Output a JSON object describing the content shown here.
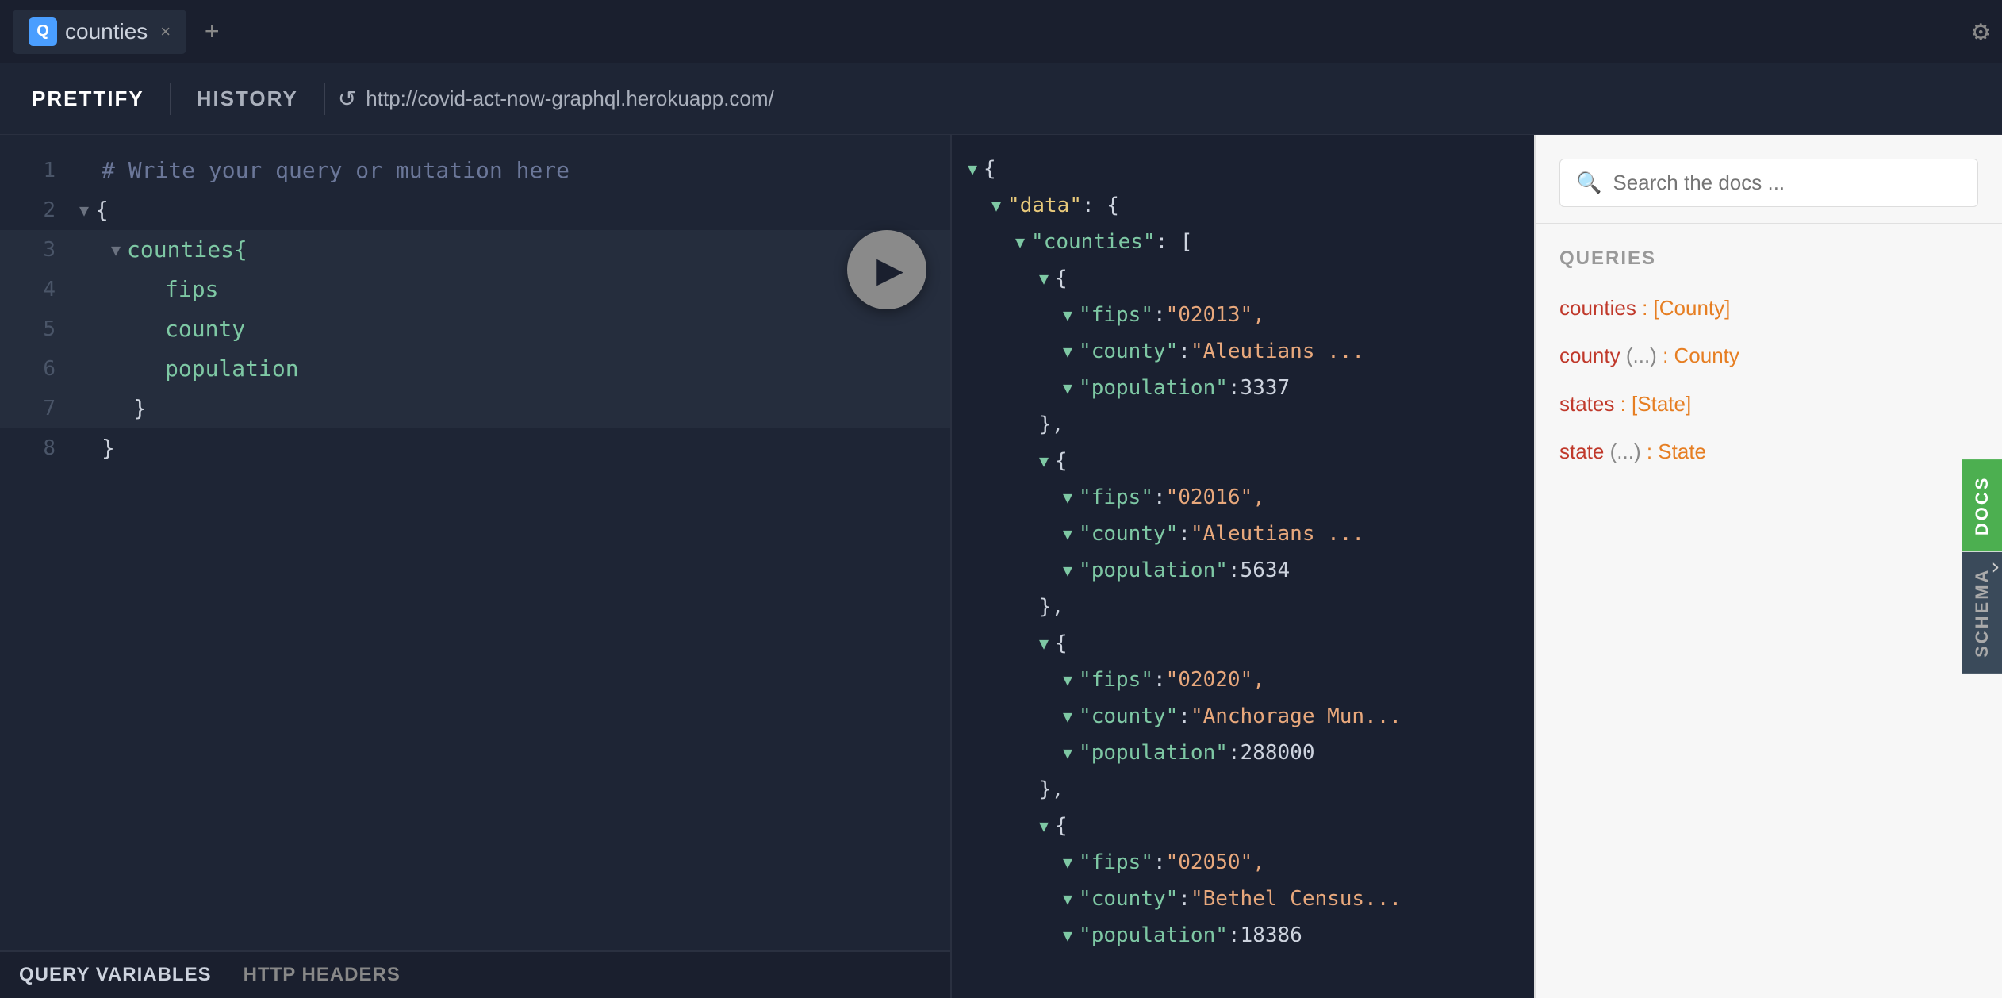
{
  "tabBar": {
    "icon": "Q",
    "tabLabel": "counties",
    "closeBtn": "×",
    "addBtn": "+",
    "settingsIcon": "⚙"
  },
  "toolbar": {
    "prettifyBtn": "PRETTIFY",
    "historyBtn": "HISTORY",
    "refreshIcon": "↺",
    "url": "http://covid-act-now-graphql.herokuapp.com/"
  },
  "editor": {
    "lines": [
      {
        "num": "1",
        "indent": 0,
        "content": "# Write your query or mutation here",
        "type": "comment"
      },
      {
        "num": "2",
        "indent": 0,
        "content": "{",
        "type": "brace",
        "arrow": "▼"
      },
      {
        "num": "3",
        "indent": 1,
        "content": "counties{",
        "type": "keyword",
        "arrow": "▼"
      },
      {
        "num": "4",
        "indent": 2,
        "content": "fips",
        "type": "field"
      },
      {
        "num": "5",
        "indent": 2,
        "content": "county",
        "type": "field"
      },
      {
        "num": "6",
        "indent": 2,
        "content": "population",
        "type": "field"
      },
      {
        "num": "7",
        "indent": 1,
        "content": "}",
        "type": "brace"
      },
      {
        "num": "8",
        "indent": 0,
        "content": "}",
        "type": "brace"
      }
    ],
    "runBtn": "▶"
  },
  "result": {
    "entries": [
      {
        "indent": 0,
        "text": "{",
        "tri": true
      },
      {
        "indent": 1,
        "key": "\"data\"",
        "colon": ": {",
        "tri": true,
        "keyType": "data"
      },
      {
        "indent": 2,
        "key": "\"counties\"",
        "colon": ": [",
        "tri": true,
        "keyType": "normal"
      },
      {
        "indent": 3,
        "text": "{",
        "tri": true
      },
      {
        "indent": 4,
        "key": "\"fips\"",
        "colon": ": ",
        "value": "\"02013\"",
        "comma": ",",
        "keyType": "normal",
        "valType": "str"
      },
      {
        "indent": 4,
        "key": "\"county\"",
        "colon": ": ",
        "value": "\"Aleutians ...",
        "comma": "",
        "keyType": "normal",
        "valType": "str"
      },
      {
        "indent": 4,
        "key": "\"population\"",
        "colon": ": ",
        "value": "3337",
        "comma": "",
        "keyType": "normal",
        "valType": "num"
      },
      {
        "indent": 3,
        "text": "},",
        "tri": false
      },
      {
        "indent": 3,
        "text": "{",
        "tri": true
      },
      {
        "indent": 4,
        "key": "\"fips\"",
        "colon": ": ",
        "value": "\"02016\"",
        "comma": ",",
        "keyType": "normal",
        "valType": "str"
      },
      {
        "indent": 4,
        "key": "\"county\"",
        "colon": ": ",
        "value": "\"Aleutians ...",
        "comma": "",
        "keyType": "normal",
        "valType": "str"
      },
      {
        "indent": 4,
        "key": "\"population\"",
        "colon": ": ",
        "value": "5634",
        "comma": "",
        "keyType": "normal",
        "valType": "num"
      },
      {
        "indent": 3,
        "text": "},",
        "tri": false
      },
      {
        "indent": 3,
        "text": "{",
        "tri": true
      },
      {
        "indent": 4,
        "key": "\"fips\"",
        "colon": ": ",
        "value": "\"02020\"",
        "comma": ",",
        "keyType": "normal",
        "valType": "str"
      },
      {
        "indent": 4,
        "key": "\"county\"",
        "colon": ": ",
        "value": "\"Anchorage Mun...",
        "comma": "",
        "keyType": "normal",
        "valType": "str"
      },
      {
        "indent": 4,
        "key": "\"population\"",
        "colon": ": ",
        "value": "288000",
        "comma": "",
        "keyType": "normal",
        "valType": "num"
      },
      {
        "indent": 3,
        "text": "},",
        "tri": false
      },
      {
        "indent": 3,
        "text": "{",
        "tri": true
      },
      {
        "indent": 4,
        "key": "\"fips\"",
        "colon": ": ",
        "value": "\"02050\"",
        "comma": ",",
        "keyType": "normal",
        "valType": "str"
      },
      {
        "indent": 4,
        "key": "\"county\"",
        "colon": ": ",
        "value": "\"Bethel Census...",
        "comma": "",
        "keyType": "normal",
        "valType": "str"
      },
      {
        "indent": 4,
        "key": "\"population\"",
        "colon": ": ",
        "value": "18386",
        "comma": "",
        "keyType": "normal",
        "valType": "num"
      }
    ]
  },
  "bottomBar": {
    "queryVarsBtn": "QUERY VARIABLES",
    "httpHeadersBtn": "HTTP HEADERS"
  },
  "docs": {
    "searchPlaceholder": "Search the docs ...",
    "queriesTitle": "QUERIES",
    "items": [
      {
        "name": "counties",
        "paren": "",
        "type": "[County]"
      },
      {
        "name": "county",
        "paren": "(...)",
        "type": "County"
      },
      {
        "name": "states",
        "paren": "",
        "type": "[State]"
      },
      {
        "name": "state",
        "paren": "(...)",
        "type": "State"
      }
    ],
    "docsTab": "DOCS",
    "schemaTab": "SCHEMA"
  }
}
